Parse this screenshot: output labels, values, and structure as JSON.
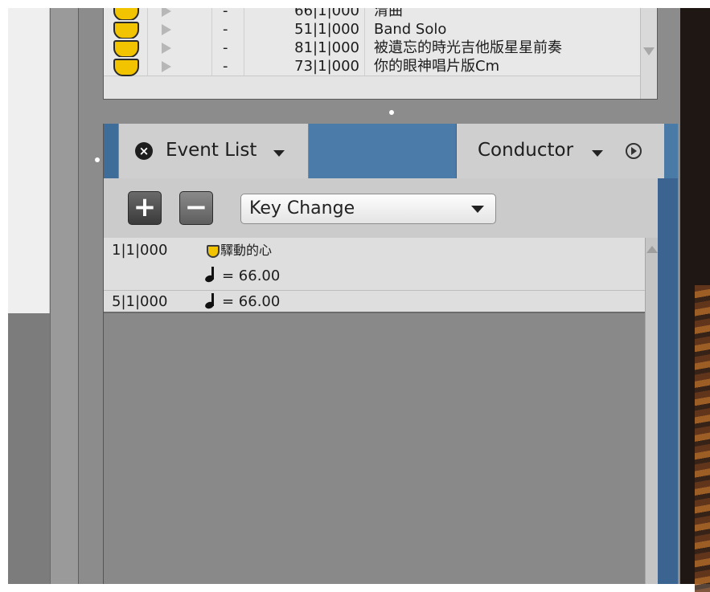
{
  "marker_list": {
    "rows": [
      {
        "dash": "-",
        "position": "66|1|000",
        "name": "清曲"
      },
      {
        "dash": "-",
        "position": "51|1|000",
        "name": "Band Solo"
      },
      {
        "dash": "-",
        "position": "81|1|000",
        "name": "被遺忘的時光吉他版星星前奏"
      },
      {
        "dash": "-",
        "position": "73|1|000",
        "name": "你的眼神唱片版Cm"
      }
    ]
  },
  "tabs": {
    "event_list": {
      "label": "Event List",
      "close_icon": "close-circle-icon",
      "menu_icon": "chevron-down-icon"
    },
    "conductor": {
      "label": "Conductor",
      "menu_icon": "chevron-down-icon",
      "play_icon": "play-circle-icon"
    }
  },
  "toolbar": {
    "add_label": "+",
    "remove_label": "−",
    "event_type": {
      "selected": "Key Change"
    }
  },
  "events": [
    {
      "position": "1|1|000",
      "marker_name": "驛動的心",
      "tempo_text": "= 66.00"
    },
    {
      "position": "5|1|000",
      "tempo_text": "= 66.00"
    }
  ],
  "colors": {
    "marker_yellow": "#f2c400",
    "tab_blue": "#4a7aa6"
  }
}
